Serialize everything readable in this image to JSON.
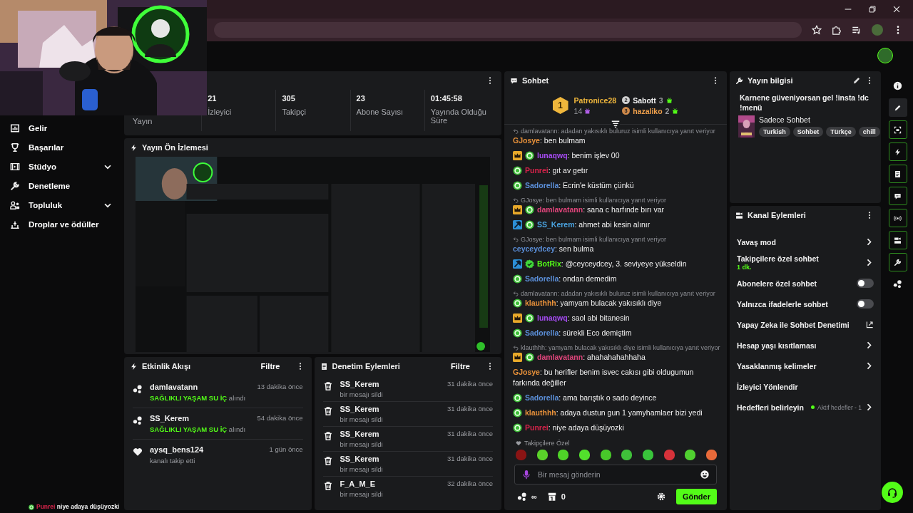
{
  "sidebar": {
    "items": [
      {
        "label": "Gelir",
        "expandable": false
      },
      {
        "label": "Başarılar",
        "expandable": false
      },
      {
        "label": "Stüdyo",
        "expandable": true
      },
      {
        "label": "Denetleme",
        "expandable": false
      },
      {
        "label": "Topluluk",
        "expandable": true
      },
      {
        "label": "Droplar ve ödüller",
        "expandable": false
      }
    ],
    "overlay_chat": {
      "user": "Punrei",
      "color": "#d6234a",
      "text": "niye adaya düşüyozki"
    }
  },
  "stats": {
    "items": [
      {
        "label": "Yayın"
      },
      {
        "value": "21",
        "label": "İzleyici"
      },
      {
        "value": "305",
        "label": "Takipçi"
      },
      {
        "value": "23",
        "label": "Abone Sayısı"
      },
      {
        "value": "01:45:58",
        "label": "Yayında Olduğu Süre"
      }
    ]
  },
  "preview": {
    "title": "Yayın Ön İzlemesi"
  },
  "activity": {
    "title": "Etkinlik Akışı",
    "filter": "Filtre",
    "events": [
      {
        "kind": "gift",
        "user": "damlavatann",
        "time": "13 dakika önce",
        "reward": "SAĞLIKLI YAŞAM SU İÇ",
        "action": "alındı"
      },
      {
        "kind": "gift",
        "user": "SS_Kerem",
        "time": "54 dakika önce",
        "reward": "SAĞLIKLI YAŞAM SU İÇ",
        "action": "alındı"
      },
      {
        "kind": "follow",
        "user": "aysq_bens124",
        "time": "1 gün önce",
        "action": "kanalı takip etti"
      }
    ]
  },
  "moderation": {
    "title": "Denetim Eylemleri",
    "filter": "Filtre",
    "actions": [
      {
        "user": "SS_Kerem",
        "time": "31 dakika önce",
        "action": "bir mesajı sildi"
      },
      {
        "user": "SS_Kerem",
        "time": "31 dakika önce",
        "action": "bir mesajı sildi"
      },
      {
        "user": "SS_Kerem",
        "time": "31 dakika önce",
        "action": "bir mesajı sildi"
      },
      {
        "user": "SS_Kerem",
        "time": "31 dakika önce",
        "action": "bir mesajı sildi"
      },
      {
        "user": "F_A_M_E",
        "time": "32 dakika önce",
        "action": "bir mesajı sildi"
      }
    ]
  },
  "chat": {
    "title": "Sohbet",
    "leaders": [
      {
        "rank": "1",
        "name": "Patronice28",
        "count": "14",
        "color": "#f0b73c"
      },
      {
        "rank": "2",
        "name": "Sabott",
        "count": "3",
        "color": "#f2f2f2"
      },
      {
        "rank": "3",
        "name": "hazaliko",
        "count": "2",
        "color": "#f0a04b"
      }
    ],
    "messages": [
      {
        "reply": "damlavatann: adadan yakısıklı buluruz isimli kullanıcıya yanıt veriyor",
        "subscriber": false,
        "moderator": false,
        "follower": false,
        "verified": false,
        "user": "GJosye",
        "color": "#e8913a",
        "text": ": ben bulmam"
      },
      {
        "subscriber": true,
        "moderator": false,
        "follower": true,
        "verified": false,
        "user": "lunaqwq",
        "color": "#a64bf4",
        "text": ": benim işlev 00"
      },
      {
        "subscriber": false,
        "moderator": false,
        "follower": true,
        "verified": false,
        "user": "Punrei",
        "color": "#d6234a",
        "text": ": gıt av getır"
      },
      {
        "subscriber": false,
        "moderator": false,
        "follower": true,
        "verified": false,
        "user": "Sadorella",
        "color": "#5b8fd9",
        "text": ": Ecrin'e küstüm çünkü"
      },
      {
        "reply": "GJosye: ben bulmam isimli kullanıcıya yanıt veriyor",
        "subscriber": true,
        "moderator": false,
        "follower": true,
        "verified": false,
        "user": "damlavatann",
        "color": "#e0457b",
        "text": ": sana c harfınde bırı var"
      },
      {
        "subscriber": false,
        "moderator": true,
        "follower": true,
        "verified": false,
        "user": "SS_Kerem",
        "color": "#4aa3df",
        "text": ": ahmet abi kesin alınır"
      },
      {
        "reply": "GJosye: ben bulmam isimli kullanıcıya yanıt veriyor",
        "subscriber": false,
        "moderator": false,
        "follower": false,
        "verified": false,
        "user": "ceyceydcey",
        "color": "#5b8fd9",
        "text": ": sen bulma"
      },
      {
        "subscriber": false,
        "moderator": true,
        "follower": false,
        "verified": true,
        "user": "BotRix",
        "color": "#53fc18",
        "text": ": @ceyceydcey, 3. seviyeye yükseldin"
      },
      {
        "subscriber": false,
        "moderator": false,
        "follower": true,
        "verified": false,
        "user": "Sadorella",
        "color": "#5b8fd9",
        "text": ": ondan demedim"
      },
      {
        "reply": "damlavatann: adadan yakısıklı buluruz isimli kullanıcıya yanıt veriyor",
        "subscriber": false,
        "moderator": false,
        "follower": true,
        "verified": false,
        "user": "klauthhh",
        "color": "#e8913a",
        "text": ": yamyam bulacak yakısıklı diye"
      },
      {
        "subscriber": true,
        "moderator": false,
        "follower": true,
        "verified": false,
        "user": "lunaqwq",
        "color": "#a64bf4",
        "text": ": saol abi bitanesin"
      },
      {
        "subscriber": false,
        "moderator": false,
        "follower": true,
        "verified": false,
        "user": "Sadorella",
        "color": "#5b8fd9",
        "text": ": sürekli Eco demiştim"
      },
      {
        "reply": "klauthhh: yamyam bulacak yakısıklı diye isimli kullanıcıya yanıt veriyor",
        "subscriber": true,
        "moderator": false,
        "follower": true,
        "verified": false,
        "user": "damlavatann",
        "color": "#e0457b",
        "text": ": ahahahahahhaha"
      },
      {
        "subscriber": false,
        "moderator": false,
        "follower": false,
        "verified": false,
        "user": "GJosye",
        "color": "#e8913a",
        "text": ": bu herifler benim isvec cakısı gibi oldugumun farkında değiller"
      },
      {
        "subscriber": false,
        "moderator": false,
        "follower": true,
        "verified": false,
        "user": "Sadorella",
        "color": "#5b8fd9",
        "text": ": ama barıştık o sado deyince"
      },
      {
        "subscriber": false,
        "moderator": false,
        "follower": true,
        "verified": false,
        "user": "klauthhh",
        "color": "#e8913a",
        "text": ": adaya dustun gun 1 yamyhamlaer bizi yedi"
      },
      {
        "subscriber": false,
        "moderator": false,
        "follower": true,
        "verified": false,
        "user": "Punrei",
        "color": "#d6234a",
        "text": ": niye adaya düşüyozki"
      }
    ],
    "emote_label": "Takipçilere Özel",
    "emotes": [
      {
        "color": "#8a1414"
      },
      {
        "color": "#5ad22a"
      },
      {
        "color": "#4fd428"
      },
      {
        "color": "#52e02c"
      },
      {
        "color": "#48c82a"
      },
      {
        "color": "#3fbf3a"
      },
      {
        "color": "#39c43b"
      },
      {
        "color": "#d6323a"
      },
      {
        "color": "#50d030"
      },
      {
        "color": "#e86a3a"
      }
    ],
    "placeholder": "Bir mesaj gönderin",
    "points": "∞",
    "store_count": "0",
    "send": "Gönder"
  },
  "stream_info": {
    "title": "Yayın bilgisi",
    "stream_title": "Karnene güveniyorsan gel !insta !dc !menü",
    "category": "Sadece Sohbet",
    "tags": [
      "Turkish",
      "Sohbet",
      "Türkçe",
      "chill"
    ]
  },
  "channel_actions": {
    "title": "Kanal Eylemleri",
    "items": [
      {
        "kind": "nav",
        "label": "Yavaş mod"
      },
      {
        "kind": "nav",
        "label": "Takipçilere özel sohbet",
        "detail": "1 dk."
      },
      {
        "kind": "toggle",
        "label": "Abonelere özel sohbet",
        "on": false
      },
      {
        "kind": "toggle",
        "label": "Yalnızca ifadelerle sohbet",
        "on": false
      },
      {
        "kind": "external",
        "label": "Yapay Zeka ile Sohbet Denetimi"
      },
      {
        "kind": "nav",
        "label": "Hesap yaşı kısıtlaması"
      },
      {
        "kind": "nav",
        "label": "Yasaklanmış kelimeler"
      },
      {
        "kind": "plain",
        "label": "İzleyici Yönlendir"
      },
      {
        "kind": "nav",
        "label": "Hedefleri belirleyin",
        "status": "Aktif hedefler - 1"
      }
    ]
  }
}
